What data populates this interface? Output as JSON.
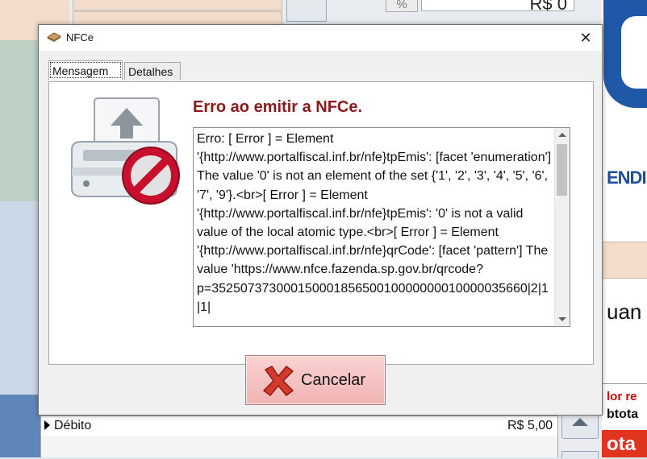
{
  "background": {
    "top_percent_button": "%",
    "top_price": "R$ 0",
    "right_banner_text": "ENDIM",
    "right_quantity_text": "uan",
    "right_valor_text": "lor re",
    "right_subtotal_text": "btota",
    "right_total_text": "ota",
    "payment_row": {
      "name": "Débito",
      "value": "R$ 5,00"
    }
  },
  "dialog": {
    "title": "NFCe",
    "close_glyph": "✕",
    "tabs": [
      {
        "label": "Mensagem",
        "active": true
      },
      {
        "label": "Detalhes",
        "active": false
      }
    ],
    "heading": "Erro ao emitir a NFCe.",
    "message": "Erro: [ Error ] = Element '{http://www.portalfiscal.inf.br/nfe}tpEmis': [facet 'enumeration'] The value '0' is not an element of the set {'1', '2', '3', '4', '5', '6', '7', '9'}.<br>[ Error ] = Element '{http://www.portalfiscal.inf.br/nfe}tpEmis': '0' is not a valid value of the local atomic type.<br>[ Error ] = Element '{http://www.portalfiscal.inf.br/nfe}qrCode': [facet 'pattern'] The value 'https://www.nfce.fazenda.sp.gov.br/qrcode?p=35250737300015000185650010000000010000035660|2|1|1|",
    "cancel_label": "Cancelar"
  },
  "colors": {
    "heading": "#8b1a1a",
    "cancel_button": "#f2b4b4",
    "logo_blue": "#1f58a6",
    "total_red": "#e0341f"
  }
}
